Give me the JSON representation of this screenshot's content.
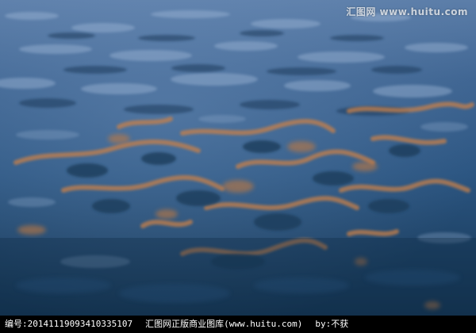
{
  "photo": {
    "subject_icon": "water-ripples-image",
    "colors": {
      "water_light": "#6f8fb8",
      "water_mid": "#2f5a85",
      "water_deep": "#163957",
      "reflection_orange": "#c8804a",
      "reflection_dark": "#1d3c5b"
    }
  },
  "watermark": {
    "text": "汇图网 www.huitu.com"
  },
  "caption": {
    "id_text": "编号:20141119093410335107",
    "site_text": "汇图网正版商业图库(www.huitu.com)",
    "author_text": "by:不获"
  }
}
